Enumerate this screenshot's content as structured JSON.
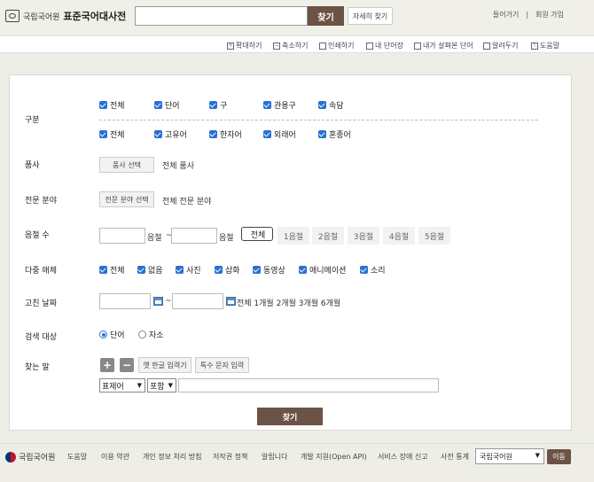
{
  "header": {
    "org_name": "국립국어원",
    "site_title": "표준국어대사전",
    "search_placeholder": "",
    "search_button": "찾기",
    "detail_search_button": "자세히 찾기",
    "login": "들어가기",
    "separator": "|",
    "signup": "회원 가입"
  },
  "toolbar": {
    "zoom_in": "확대하기",
    "zoom_out": "축소하기",
    "print": "인쇄하기",
    "my_words": "내 단어장",
    "my_viewed": "내가 살펴본 단어",
    "report": "알려두기",
    "help": "도움말"
  },
  "form": {
    "category": {
      "label": "구분",
      "row1": [
        "전체",
        "단어",
        "구",
        "관용구",
        "속담"
      ],
      "row2": [
        "전체",
        "고유어",
        "한자어",
        "외래어",
        "혼종어"
      ]
    },
    "pos": {
      "label": "품사",
      "button": "품사 선택",
      "value": "전체 품사"
    },
    "field": {
      "label": "전문 분야",
      "button": "전문 분야 선택",
      "value": "전체 전문 분야"
    },
    "syllables": {
      "label": "음절 수",
      "unit": "음절",
      "tilde": "~",
      "options": [
        "전체",
        "1음절",
        "2음절",
        "3음절",
        "4음절",
        "5음절"
      ],
      "selected": "전체"
    },
    "multimedia": {
      "label": "다중 매체",
      "options": [
        "전체",
        "없음",
        "사진",
        "삽화",
        "동영상",
        "애니메이션",
        "소리"
      ]
    },
    "revision_date": {
      "label": "고친 날짜",
      "tilde": "~",
      "presets": "전체 1개월 2개월 3개월 6개월"
    },
    "target": {
      "label": "검색 대상",
      "options": [
        "단어",
        "자소"
      ],
      "selected": "단어"
    },
    "query": {
      "label": "찾는 말",
      "plus": "+",
      "minus": "−",
      "old_hangul": "옛 한글 입력기",
      "special_chars": "특수 문자 입력",
      "field_select": "표제어",
      "match_select": "포함"
    },
    "submit": "찾기"
  },
  "footer": {
    "org": "국립국어원",
    "links": [
      "도움말",
      "이용 약관",
      "개인 정보 처리 방침",
      "저작권 정책",
      "알립니다",
      "개발 지원(Open API)",
      "서비스 장애 신고",
      "사전 통계"
    ],
    "site_select": "국립국어원",
    "go_button": "이동"
  },
  "colors": {
    "accent": "#6b5345",
    "checkbox": "#2a6fd6",
    "background": "#eeeee6"
  }
}
